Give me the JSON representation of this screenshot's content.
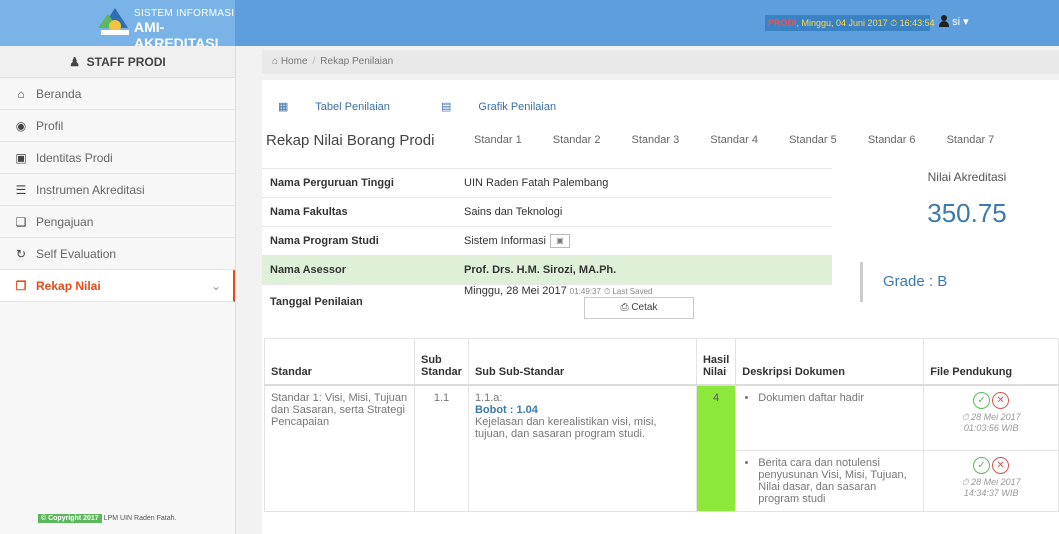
{
  "header": {
    "brand_small": "SISTEM INFORMASI",
    "brand_big": "AMI-AKREDITASI",
    "status_prodi": "PRODI",
    "status_rest": ", Minggu, 04 Juni 2017 ⏱ 16:43:54",
    "user_label": "si",
    "colors": {
      "header": "#5c9fdc",
      "brand": "#79b3e8",
      "accent": "#e74c1c"
    }
  },
  "sidebar": {
    "title": "STAFF PRODI",
    "items": [
      {
        "label": "Beranda",
        "icon": "home-icon"
      },
      {
        "label": "Profil",
        "icon": "profile-icon"
      },
      {
        "label": "Identitas Prodi",
        "icon": "id-card-icon"
      },
      {
        "label": "Instrumen Akreditasi",
        "icon": "list-icon"
      },
      {
        "label": "Pengajuan",
        "icon": "copy-icon"
      },
      {
        "label": "Self Evaluation",
        "icon": "refresh-icon"
      },
      {
        "label": "Rekap Nilai",
        "icon": "clone-icon"
      }
    ],
    "copyright_badge": "© Copyright 2017",
    "copyright_text": "LPM UIN Raden Fatah."
  },
  "breadcrumb": {
    "home": "Home",
    "current": "Rekap Penilaian"
  },
  "tabs": {
    "tabel": "Tabel Penilaian",
    "grafik": "Grafik Penilaian"
  },
  "page_title": "Rekap Nilai Borang Prodi",
  "standards": [
    "Standar 1",
    "Standar 2",
    "Standar 3",
    "Standar 4",
    "Standar 5",
    "Standar 6",
    "Standar 7"
  ],
  "info": {
    "pt_label": "Nama Perguruan Tinggi",
    "pt_value": "UIN Raden Fatah Palembang",
    "fak_label": "Nama Fakultas",
    "fak_value": "Sains dan Teknologi",
    "prodi_label": "Nama Program Studi",
    "prodi_value": "Sistem Informasi",
    "asesor_label": "Nama Asessor",
    "asesor_value": "Prof. Drs. H.M. Sirozi, MA.Ph.",
    "tgl_label": "Tanggal Penilaian",
    "tgl_value": "Minggu, 28 Mei 2017",
    "tgl_time": "01:49:37",
    "last_saved": "⏱ Last Saved",
    "cetak_label": "Cetak"
  },
  "score": {
    "label": "Nilai Akreditasi",
    "value": "350.75",
    "grade": "Grade : B"
  },
  "table": {
    "headers": {
      "standar": "Standar",
      "sub": "Sub Standar",
      "subsub": "Sub Sub-Standar",
      "hasil": "Hasil Nilai",
      "desk": "Deskripsi Dokumen",
      "file": "File Pendukung"
    },
    "row": {
      "standar": "Standar 1: Visi, Misi, Tujuan dan Sasaran, serta Strategi Pencapaian",
      "sub": "1.1",
      "code": "1.1.a:",
      "bobot": "Bobot : 1.04",
      "desc": "Kejelasan dan kerealistikan visi, misi, tujuan, dan sasaran program studi.",
      "nilai": "4",
      "docs": [
        {
          "text": "Dokumen daftar hadir",
          "date": "⏱ 28 Mei 2017",
          "time": "01:03:56 WIB"
        },
        {
          "text": "Berita cara dan notulensi penyusunan Visi, Misi, Tujuan, Nilai dasar, dan sasaran program studi",
          "date": "⏱ 28 Mei 2017",
          "time": "14:34:37 WIB"
        }
      ]
    }
  }
}
